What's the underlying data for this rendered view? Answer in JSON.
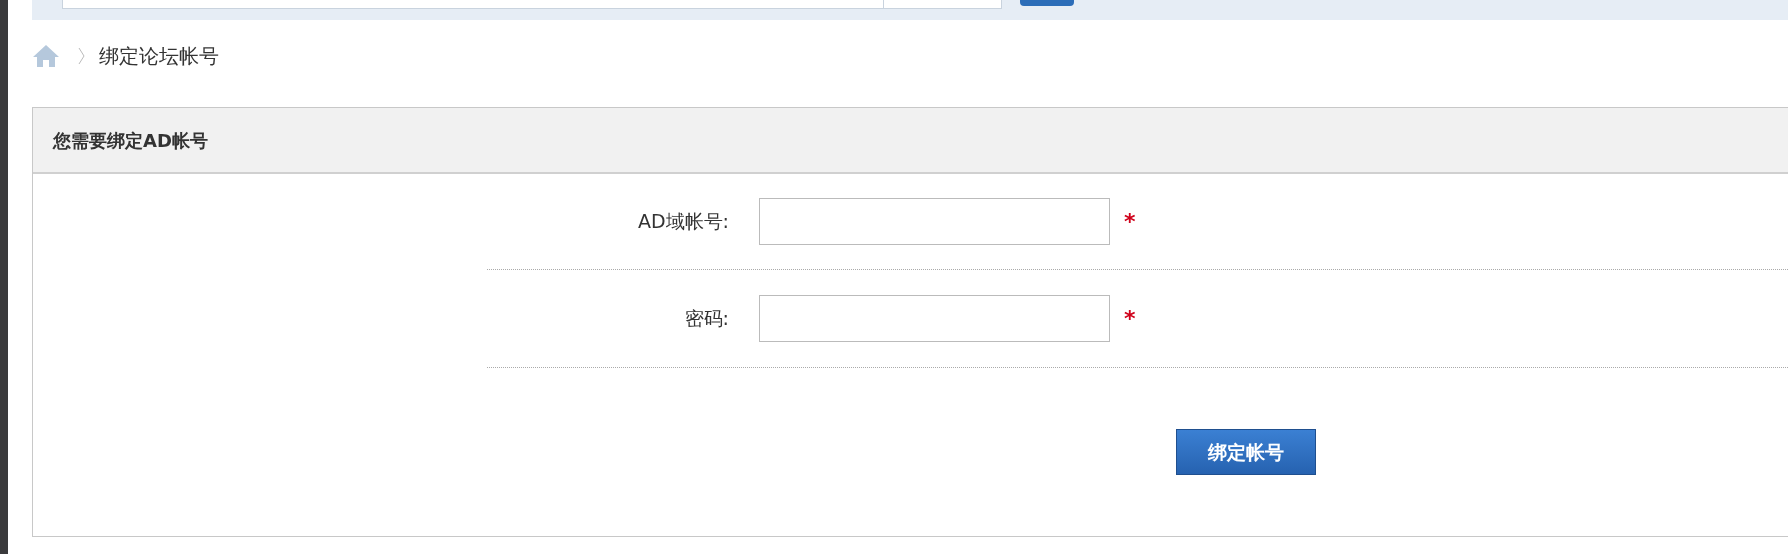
{
  "breadcrumb": {
    "current": "绑定论坛帐号"
  },
  "panel": {
    "title": "您需要绑定AD帐号",
    "fields": [
      {
        "label": "AD域帐号:",
        "required": true
      },
      {
        "label": "密码:",
        "required": true
      }
    ],
    "required_mark": "*",
    "submit": "绑定帐号"
  }
}
